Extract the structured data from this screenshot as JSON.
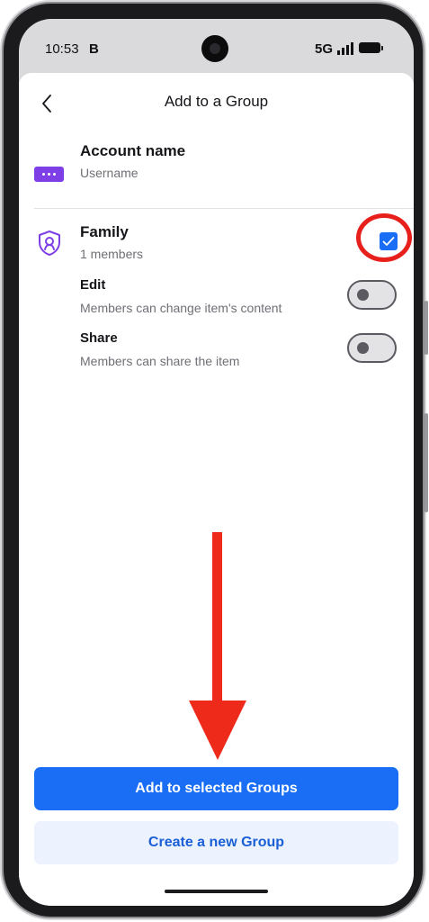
{
  "status_bar": {
    "time": "10:53",
    "carrier_icon": "B",
    "network": "5G",
    "signal_icon": "signal-bars-icon",
    "battery_icon": "battery-icon"
  },
  "header": {
    "back_icon": "chevron-left-icon",
    "title": "Add to a Group"
  },
  "item": {
    "icon": "password-dots-icon",
    "name": "Account name",
    "username": "Username"
  },
  "groups": [
    {
      "icon": "shield-user-icon",
      "name": "Family",
      "members": "1 members",
      "selected": true,
      "permissions": [
        {
          "title": "Edit",
          "description": "Members can change item's content",
          "enabled": false
        },
        {
          "title": "Share",
          "description": "Members can share the item",
          "enabled": false
        }
      ]
    }
  ],
  "actions": {
    "primary": "Add to selected Groups",
    "secondary": "Create a new Group"
  },
  "colors": {
    "accent": "#1a6ef5",
    "brand_purple": "#7f3fe6",
    "annotation_red": "#ee2a1a"
  }
}
